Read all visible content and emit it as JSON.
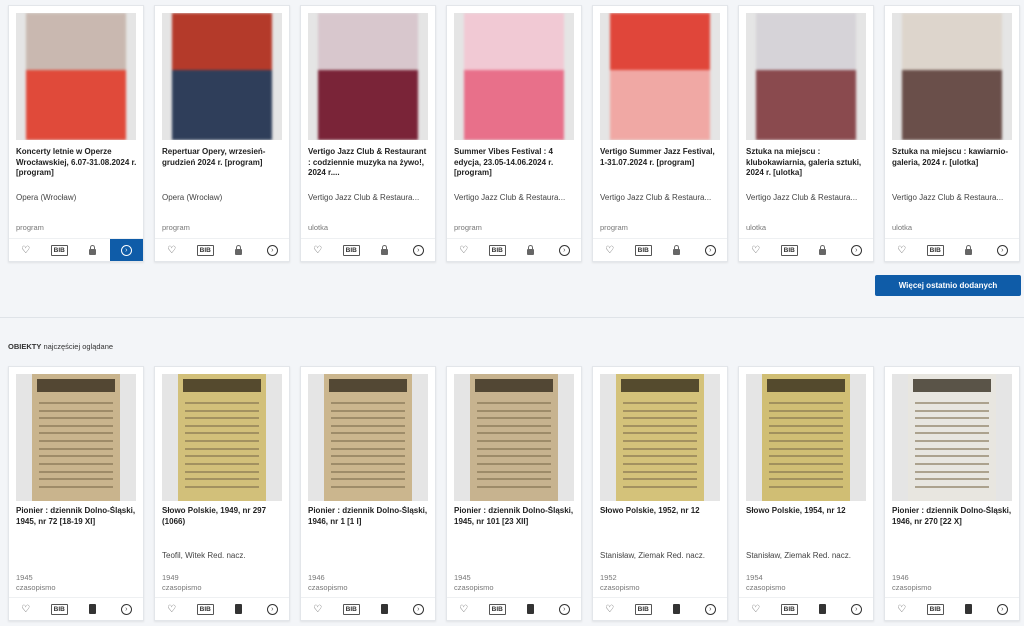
{
  "recent": [
    {
      "title": "Koncerty letnie w Operze Wrocławskiej, 6.07-31.08.2024 r. [program]",
      "author": "Opera (Wrocław)",
      "type": "program",
      "thumb": "#e04a3a",
      "thumb2": "#c9b8b0",
      "active": true
    },
    {
      "title": "Repertuar Opery, wrzesień-grudzień 2024 r. [program]",
      "author": "Opera (Wrocław)",
      "type": "program",
      "thumb": "#2f3e5a",
      "thumb2": "#b43a2a",
      "active": false
    },
    {
      "title": "Vertigo Jazz Club & Restaurant : codziennie muzyka na żywo!, 2024 r....",
      "author": "Vertigo Jazz Club & Restaura...",
      "type": "ulotka",
      "thumb": "#7a2438",
      "thumb2": "#d8c7cd",
      "active": false
    },
    {
      "title": "Summer Vibes Festival : 4 edycja, 23.05-14.06.2024 r. [program]",
      "author": "Vertigo Jazz Club & Restaura...",
      "type": "program",
      "thumb": "#e8708a",
      "thumb2": "#f1c9d4",
      "active": false
    },
    {
      "title": "Vertigo Summer Jazz Festival, 1-31.07.2024 r. [program]",
      "author": "Vertigo Jazz Club & Restaura...",
      "type": "program",
      "thumb": "#f0a8a4",
      "thumb2": "#e0463a",
      "active": false
    },
    {
      "title": "Sztuka na miejscu : klubokawiarnia, galeria sztuki, 2024 r. [ulotka]",
      "author": "Vertigo Jazz Club & Restaura...",
      "type": "ulotka",
      "thumb": "#8a4a4e",
      "thumb2": "#d6d3d8",
      "active": false
    },
    {
      "title": "Sztuka na miejscu : kawiarnio-galeria, 2024 r. [ulotka]",
      "author": "Vertigo Jazz Club & Restaura...",
      "type": "ulotka",
      "thumb": "#6a4f4a",
      "thumb2": "#ddd5cc",
      "active": false
    }
  ],
  "more_button": "Więcej ostatnio dodanych",
  "section": {
    "bold": "OBIEKTY",
    "rest": "najczęściej oglądane"
  },
  "viewed": [
    {
      "title": "Pionier : dziennik Dolno-Śląski, 1945, nr 72 [18-19 XI]",
      "author": "",
      "year": "1945",
      "type": "czasopismo",
      "paper": "#c9b48d"
    },
    {
      "title": "Słowo Polskie, 1949, nr 297 (1066)",
      "author": "Teofil, Witek Red. nacz.",
      "year": "1949",
      "type": "czasopismo",
      "paper": "#d2c07a"
    },
    {
      "title": "Pionier : dziennik Dolno-Śląski, 1946, nr 1 [1 I]",
      "author": "",
      "year": "1946",
      "type": "czasopismo",
      "paper": "#cbb68e"
    },
    {
      "title": "Pionier : dziennik Dolno-Śląski, 1945, nr 101 [23 XII]",
      "author": "",
      "year": "1945",
      "type": "czasopismo",
      "paper": "#c7b38f"
    },
    {
      "title": "Słowo Polskie, 1952, nr 12",
      "author": "Stanisław, Ziemak Red. nacz.",
      "year": "1952",
      "type": "czasopismo",
      "paper": "#d4c27a"
    },
    {
      "title": "Słowo Polskie, 1954, nr 12",
      "author": "Stanisław, Ziemak Red. nacz.",
      "year": "1954",
      "type": "czasopismo",
      "paper": "#d0be74"
    },
    {
      "title": "Pionier : dziennik Dolno-Śląski, 1946, nr 270 [22 X]",
      "author": "",
      "year": "1946",
      "type": "czasopismo",
      "paper": "#e8e6e0"
    }
  ],
  "actions": {
    "bib": "BIB"
  }
}
